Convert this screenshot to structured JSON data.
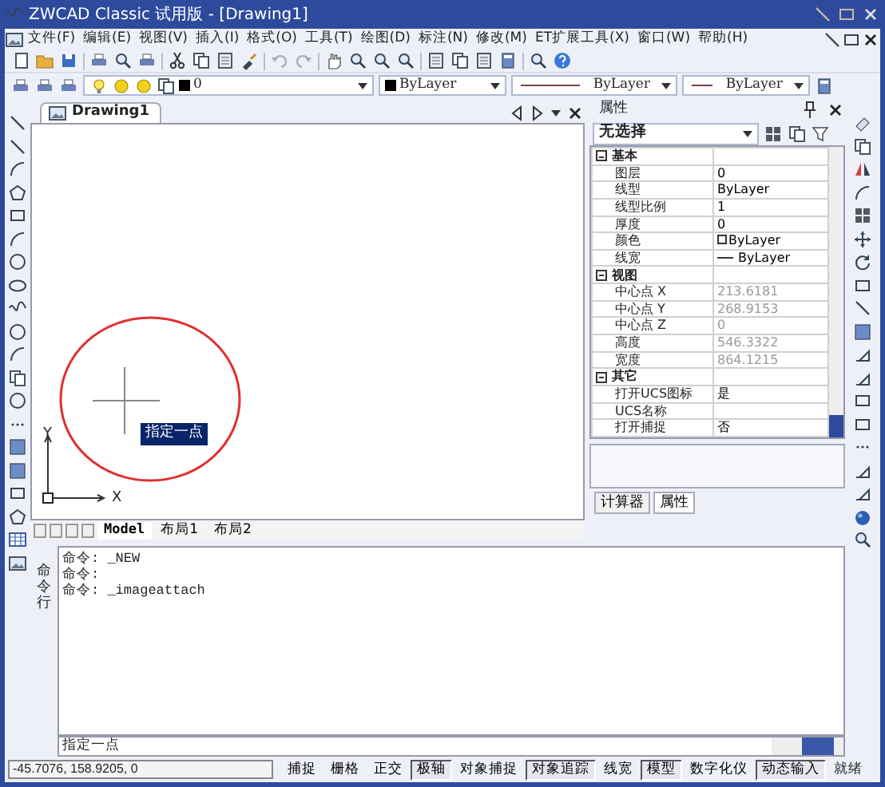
{
  "window": {
    "title": "ZWCAD Classic 试用版 - [Drawing1]"
  },
  "menu": [
    "文件(F)",
    "编辑(E)",
    "视图(V)",
    "插入(I)",
    "格式(O)",
    "工具(T)",
    "绘图(D)",
    "标注(N)",
    "修改(M)",
    "ET扩展工具(X)",
    "窗口(W)",
    "帮助(H)"
  ],
  "layer_toolbar": {
    "layer": "0",
    "color_setting": "ByLayer",
    "linetype": "ByLayer",
    "lineweight": "ByLayer"
  },
  "document_tab": {
    "title": "Drawing1"
  },
  "canvas": {
    "tooltip": "指定一点",
    "axis_x": "X",
    "axis_y": "Y"
  },
  "layout_tabs": [
    {
      "label": "Model",
      "selected": true
    },
    {
      "label": "布局1",
      "selected": false
    },
    {
      "label": "布局2",
      "selected": false
    }
  ],
  "properties": {
    "title": "属性",
    "selection": "无选择",
    "sections": [
      {
        "title": "基本",
        "expanded": true,
        "rows": [
          {
            "label": "图层",
            "value": "0",
            "kind": "text",
            "disabled": false
          },
          {
            "label": "线型",
            "value": "ByLayer",
            "kind": "text",
            "disabled": false
          },
          {
            "label": "线型比例",
            "value": "1",
            "kind": "text",
            "disabled": false
          },
          {
            "label": "厚度",
            "value": "0",
            "kind": "text",
            "disabled": false
          },
          {
            "label": "颜色",
            "value": "ByLayer",
            "kind": "color",
            "disabled": false
          },
          {
            "label": "线宽",
            "value": "ByLayer",
            "kind": "lineweight",
            "disabled": false
          }
        ]
      },
      {
        "title": "视图",
        "expanded": true,
        "rows": [
          {
            "label": "中心点 X",
            "value": "213.6181",
            "kind": "text",
            "disabled": true
          },
          {
            "label": "中心点 Y",
            "value": "268.9153",
            "kind": "text",
            "disabled": true
          },
          {
            "label": "中心点 Z",
            "value": "0",
            "kind": "text",
            "disabled": true
          },
          {
            "label": "高度",
            "value": "546.3322",
            "kind": "text",
            "disabled": true
          },
          {
            "label": "宽度",
            "value": "864.1215",
            "kind": "text",
            "disabled": true
          }
        ]
      },
      {
        "title": "其它",
        "expanded": true,
        "rows": [
          {
            "label": "打开UCS图标",
            "value": "是",
            "kind": "text",
            "disabled": false
          },
          {
            "label": "UCS名称",
            "value": "",
            "kind": "text",
            "disabled": false
          },
          {
            "label": "打开捕捉",
            "value": "否",
            "kind": "text",
            "disabled": false
          }
        ]
      }
    ]
  },
  "panel_tabs": [
    {
      "label": "计算器",
      "selected": false
    },
    {
      "label": "属性",
      "selected": true
    }
  ],
  "command": {
    "label": "命令行",
    "history": [
      "命令: _NEW",
      "命令:",
      "命令: _imageattach"
    ],
    "prompt": "指定一点"
  },
  "status": {
    "coordinates": "-45.7076,  158.9205,  0",
    "state": "就绪",
    "toggles": [
      {
        "label": "捕捉",
        "on": false
      },
      {
        "label": "栅格",
        "on": false
      },
      {
        "label": "正交",
        "on": false
      },
      {
        "label": "极轴",
        "on": true
      },
      {
        "label": "对象捕捉",
        "on": false
      },
      {
        "label": "对象追踪",
        "on": true
      },
      {
        "label": "线宽",
        "on": false
      },
      {
        "label": "模型",
        "on": true
      },
      {
        "label": "数字化仪",
        "on": false
      },
      {
        "label": "动态输入",
        "on": true
      }
    ]
  }
}
